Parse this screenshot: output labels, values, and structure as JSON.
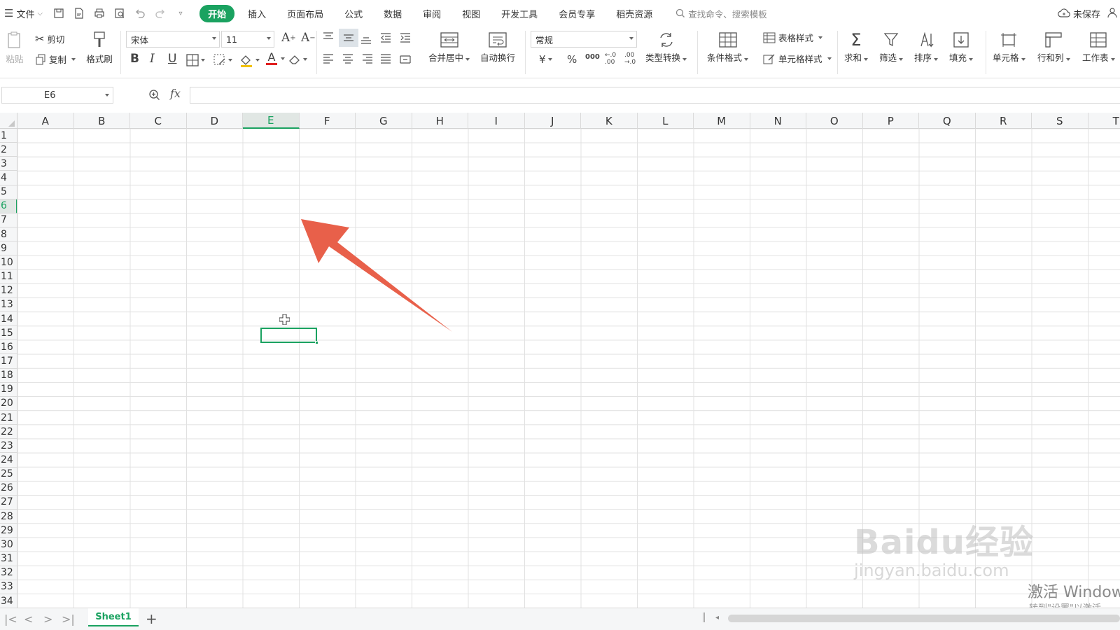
{
  "menubar": {
    "file_label": "文件",
    "tabs": [
      "开始",
      "插入",
      "页面布局",
      "公式",
      "数据",
      "审阅",
      "视图",
      "开发工具",
      "会员专享",
      "稻壳资源"
    ],
    "active_tab": "开始",
    "search_placeholder": "查找命令、搜索模板",
    "unsaved_label": "未保存"
  },
  "ribbon": {
    "paste": "粘贴",
    "cut": "剪切",
    "copy": "复制",
    "format_painter": "格式刷",
    "font_name": "宋体",
    "font_size": "11",
    "bold": "B",
    "italic": "I",
    "underline": "U",
    "font_color_glyph": "A",
    "merge_center": "合并居中",
    "wrap_text": "自动换行",
    "number_format": "常规",
    "currency": "¥",
    "percent": "%",
    "thousands": "000",
    "inc_decimal": "←.0\n.00",
    "dec_decimal": ".00\n→.0",
    "type_convert": "类型转换",
    "conditional_format": "条件格式",
    "table_style": "表格样式",
    "cell_style": "单元格样式",
    "sum": "求和",
    "filter": "筛选",
    "sort": "排序",
    "fill": "填充",
    "cells": "单元格",
    "rows_cols": "行和列",
    "worksheet": "工作表"
  },
  "formula_bar": {
    "name_box": "E6",
    "fx": "fx",
    "formula": ""
  },
  "grid": {
    "columns": [
      "A",
      "B",
      "C",
      "D",
      "E",
      "F",
      "G",
      "H",
      "I",
      "J",
      "K",
      "L",
      "M",
      "N",
      "O",
      "P",
      "Q",
      "R",
      "S",
      "T"
    ],
    "rows": [
      "1",
      "2",
      "3",
      "4",
      "5",
      "6",
      "7",
      "8",
      "9",
      "10",
      "11",
      "12",
      "13",
      "14",
      "15",
      "16",
      "17",
      "18",
      "19",
      "20",
      "21",
      "22",
      "23",
      "24",
      "25",
      "26",
      "27",
      "28",
      "29",
      "30",
      "31",
      "32",
      "33",
      "34"
    ],
    "selected_column": "E",
    "selected_row": "6"
  },
  "watermark": {
    "brand": "Baidu经验",
    "url": "jingyan.baidu.com",
    "activate_title": "激活 Windows",
    "activate_sub": "转到\"设置\"以激活"
  },
  "sheets": {
    "tabs": [
      "Sheet1"
    ],
    "add_label": "+"
  },
  "colors": {
    "accent": "#1aa260",
    "annotation_arrow": "#e8604a"
  }
}
